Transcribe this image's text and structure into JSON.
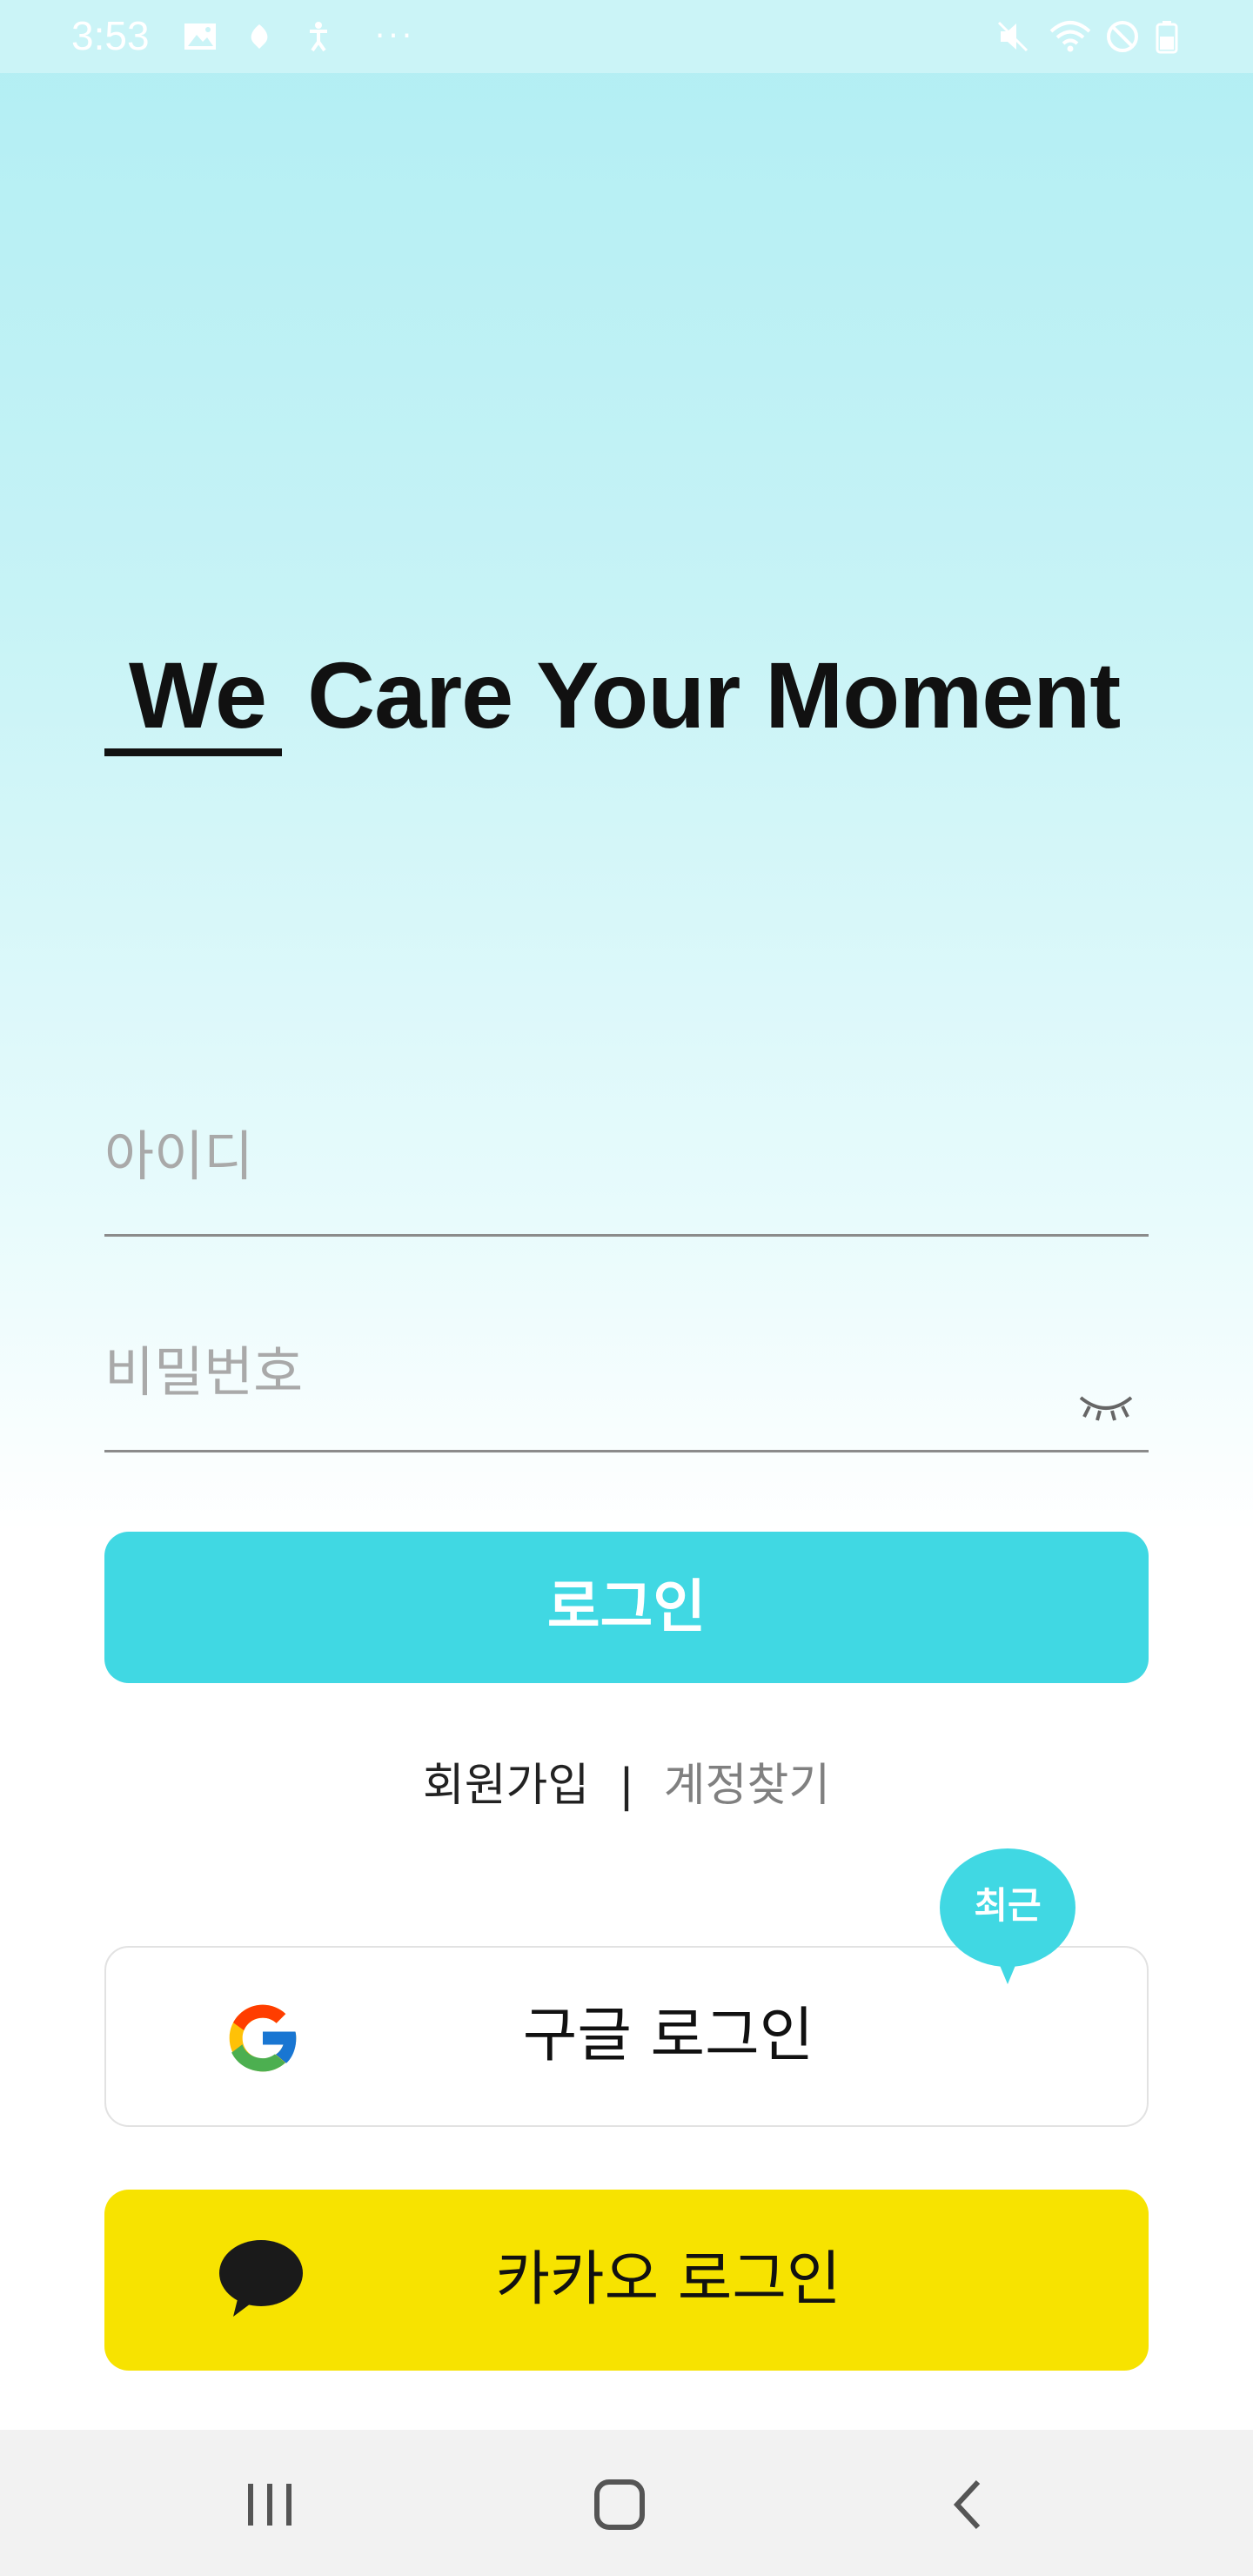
{
  "status_bar": {
    "time": "3:53",
    "left_icons": [
      "gallery-icon",
      "leaf-icon",
      "accessibility-icon",
      "more-dots-icon"
    ],
    "right_icons": [
      "mute-icon",
      "wifi-icon",
      "blocked-icon",
      "battery-icon"
    ]
  },
  "headline": {
    "we": "We",
    "rest": " Care Your Moment"
  },
  "form": {
    "id_placeholder": "아이디",
    "password_placeholder": "비밀번호",
    "login_label": "로그인"
  },
  "links": {
    "signup": "회원가입",
    "separator": "|",
    "find_account": "계정찾기"
  },
  "recent_badge": "최근",
  "social": {
    "google_label": "구글 로그인",
    "kakao_label": "카카오 로그인"
  },
  "nav": [
    "recent-apps-icon",
    "home-icon",
    "back-icon"
  ],
  "colors": {
    "accent": "#40d8e3",
    "kakao": "#f7e300",
    "background_top": "#b1eef3"
  }
}
